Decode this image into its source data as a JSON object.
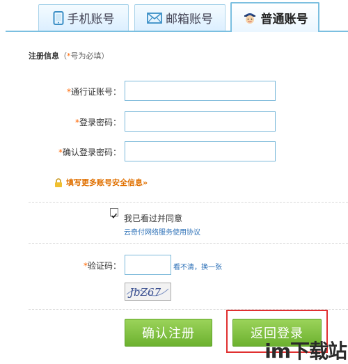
{
  "tabs": [
    {
      "label": "手机账号",
      "icon": "phone-icon"
    },
    {
      "label": "邮箱账号",
      "icon": "mail-icon"
    },
    {
      "label": "普通账号",
      "icon": "avatar-icon",
      "active": true
    }
  ],
  "form": {
    "title": "注册信息",
    "required_note_open": "（",
    "required_note_star": "*",
    "required_note_text": "号为必填）",
    "fields": {
      "account_label": "通行证账号：",
      "password_label": "登录密码：",
      "confirm_password_label": "确认登录密码："
    },
    "star": "*",
    "more_info": "填写更多账号安全信息»"
  },
  "agreement": {
    "checked": true,
    "text": "我已看过并同意",
    "link": "云奇付网络服务使用协议"
  },
  "captcha": {
    "label": "验证码：",
    "refresh": "看不清，换一张",
    "image_text": "JbZ67"
  },
  "buttons": {
    "confirm": "确认注册",
    "back": "返回登录"
  },
  "watermark": "im下载站",
  "colors": {
    "accent_blue": "#7bbfe0",
    "required_star": "#ff6600",
    "link_blue": "#2f72b8",
    "button_green": "#6cb12f",
    "highlight_red": "#e03030"
  }
}
